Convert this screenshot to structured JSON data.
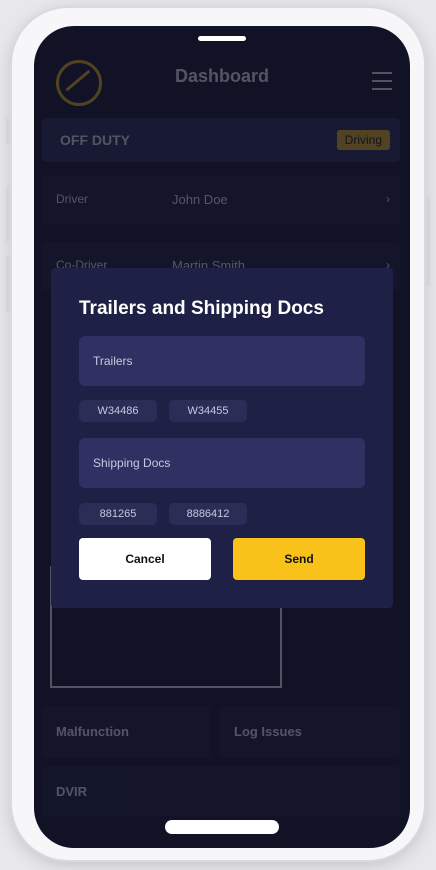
{
  "app": {
    "title": "Dashboard",
    "status": "OFF DUTY",
    "status_badge": "Driving",
    "rows": [
      {
        "label": "Driver",
        "value": "John Doe"
      },
      {
        "label": "Co-Driver",
        "value": "Martin Smith"
      }
    ],
    "bottom": {
      "malfunction": "Malfunction",
      "log_issues": "Log Issues",
      "dvir": "DVIR"
    }
  },
  "modal": {
    "title": "Trailers and Shipping Docs",
    "trailers_placeholder": "Trailers",
    "trailers": [
      "W34486",
      "W34455"
    ],
    "shipping_placeholder": "Shipping Docs",
    "shipping_docs": [
      "881265",
      "8886412"
    ],
    "cancel_label": "Cancel",
    "send_label": "Send"
  },
  "colors": {
    "accent": "#f8c21b",
    "modal_bg": "#1f2046",
    "field_bg": "#2f3163",
    "screen_bg": "#111226"
  }
}
